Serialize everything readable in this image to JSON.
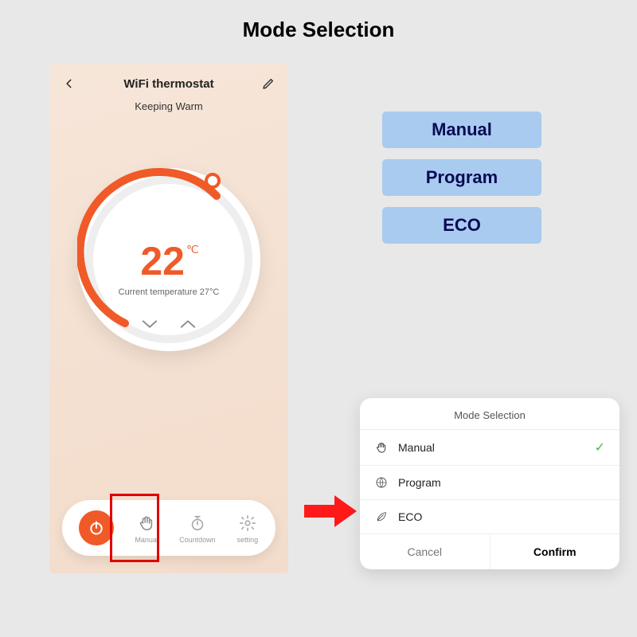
{
  "page_title": "Mode Selection",
  "phone": {
    "app_title": "WiFi thermostat",
    "status": "Keeping Warm",
    "set_temperature": "22",
    "temp_unit": "℃",
    "current_temperature_label": "Current temperature 27°C",
    "bottom_bar": {
      "manual": "Manual",
      "countdown": "Countdown",
      "setting": "setting"
    }
  },
  "pills": {
    "manual": "Manual",
    "program": "Program",
    "eco": "ECO"
  },
  "modal": {
    "title": "Mode Selection",
    "rows": {
      "manual": "Manual",
      "program": "Program",
      "eco": "ECO"
    },
    "cancel": "Cancel",
    "confirm": "Confirm"
  },
  "colors": {
    "accent": "#f05a28",
    "highlight": "#e10000",
    "pill_bg": "#a9cbef",
    "pill_text": "#0a0a55",
    "check": "#3bbf4a"
  }
}
